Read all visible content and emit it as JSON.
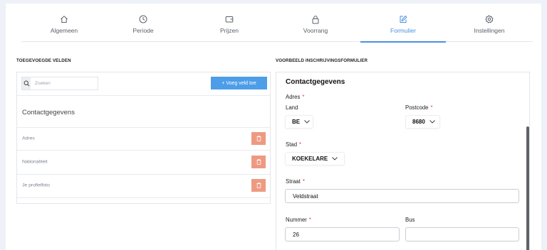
{
  "tabs": [
    {
      "label": "Algemeen",
      "icon": "home-icon"
    },
    {
      "label": "Periode",
      "icon": "clock-icon"
    },
    {
      "label": "Prijzen",
      "icon": "wallet-icon"
    },
    {
      "label": "Voorrang",
      "icon": "lock-icon"
    },
    {
      "label": "Formulier",
      "icon": "edit-icon",
      "active": true
    },
    {
      "label": "Instellingen",
      "icon": "gear-icon"
    }
  ],
  "left": {
    "title": "TOEGEVOEGDE VELDEN",
    "search_placeholder": "Zoeken",
    "add_button": "+ Voeg veld toe",
    "group_title": "Contactgegevens",
    "fields": [
      "Adres",
      "Nationaliteit",
      "Je profielfoto"
    ]
  },
  "right": {
    "title": "VOORBEELD INSCHRIJVINGSFORMULIER",
    "form_title": "Contactgegevens",
    "adres_label": "Adres",
    "land_label": "Land",
    "land_value": "BE",
    "postcode_label": "Postcode",
    "postcode_value": "8680",
    "stad_label": "Stad",
    "stad_value": "KOEKELARE",
    "straat_label": "Straat",
    "straat_value": "Veldstraat",
    "nummer_label": "Nummer",
    "nummer_value": "26",
    "bus_label": "Bus",
    "bus_value": "",
    "required_mark": "*"
  },
  "colors": {
    "accent": "#4a90e2",
    "add_button": "#4d9de8",
    "delete_button": "#ee9a82",
    "required": "#e8434a",
    "background": "#eef1f7"
  }
}
